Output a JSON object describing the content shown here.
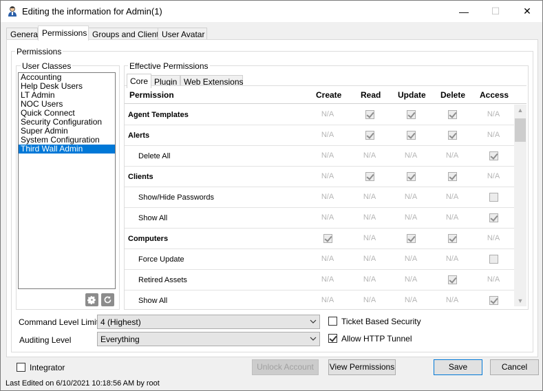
{
  "window": {
    "title": "Editing the information for Admin(1)",
    "minimize_glyph": "—",
    "maximize_glyph": "☐",
    "close_glyph": "✕"
  },
  "tabs": [
    {
      "label": "General"
    },
    {
      "label": "Permissions"
    },
    {
      "label": "Groups and Clients"
    },
    {
      "label": "User Avatar"
    }
  ],
  "permissions_group": {
    "label": "Permissions"
  },
  "user_classes": {
    "label": "User Classes",
    "items": [
      "Accounting",
      "Help Desk Users",
      "LT Admin",
      "NOC Users",
      "Quick Connect",
      "Security Configuration",
      "Super Admin",
      "System Configuration",
      "Third Wall Admin"
    ],
    "selected_index": 8,
    "settings_icon": "gear-icon",
    "refresh_icon": "refresh-icon"
  },
  "effective": {
    "label": "Effective Permissions",
    "subtabs": [
      {
        "label": "Core"
      },
      {
        "label": "Plugin"
      },
      {
        "label": "Web Extensions"
      }
    ],
    "columns": {
      "permission": "Permission",
      "create": "Create",
      "read": "Read",
      "update": "Update",
      "delete": "Delete",
      "access": "Access"
    },
    "rows": [
      {
        "name": "Agent Templates",
        "level": "main",
        "create": "N/A",
        "read": "checked",
        "update": "checked",
        "delete": "checked",
        "access": "N/A"
      },
      {
        "name": "Alerts",
        "level": "main",
        "create": "N/A",
        "read": "checked",
        "update": "checked",
        "delete": "checked",
        "access": "N/A"
      },
      {
        "name": "Delete All",
        "level": "sub",
        "create": "N/A",
        "read": "N/A",
        "update": "N/A",
        "delete": "N/A",
        "access": "checked"
      },
      {
        "name": "Clients",
        "level": "main",
        "create": "N/A",
        "read": "checked",
        "update": "checked",
        "delete": "checked",
        "access": "N/A"
      },
      {
        "name": "Show/Hide Passwords",
        "level": "sub",
        "create": "N/A",
        "read": "N/A",
        "update": "N/A",
        "delete": "N/A",
        "access": "unchecked"
      },
      {
        "name": "Show All",
        "level": "sub",
        "create": "N/A",
        "read": "N/A",
        "update": "N/A",
        "delete": "N/A",
        "access": "checked"
      },
      {
        "name": "Computers",
        "level": "main",
        "create": "checked",
        "read": "N/A",
        "update": "checked",
        "delete": "checked",
        "access": "N/A"
      },
      {
        "name": "Force Update",
        "level": "sub",
        "create": "N/A",
        "read": "N/A",
        "update": "N/A",
        "delete": "N/A",
        "access": "unchecked"
      },
      {
        "name": "Retired Assets",
        "level": "sub",
        "create": "N/A",
        "read": "N/A",
        "update": "N/A",
        "delete": "checked",
        "access": "N/A"
      },
      {
        "name": "Show All",
        "level": "sub",
        "create": "N/A",
        "read": "N/A",
        "update": "N/A",
        "delete": "N/A",
        "access": "checked"
      }
    ]
  },
  "command_level": {
    "label": "Command Level Limit",
    "value": "4 (Highest)"
  },
  "auditing_level": {
    "label": "Auditing Level",
    "value": "Everything"
  },
  "ticket_based_security": {
    "label": "Ticket Based Security",
    "checked": false
  },
  "allow_http_tunnel": {
    "label": "Allow HTTP Tunnel",
    "checked": true
  },
  "integrator": {
    "label": "Integrator",
    "checked": false
  },
  "buttons": {
    "unlock_account": "Unlock Account",
    "view_permissions": "View Permissions",
    "save": "Save",
    "cancel": "Cancel"
  },
  "status": {
    "text": "Last Edited on 6/10/2021 10:18:56 AM by root"
  },
  "colors": {
    "selection": "#0078d7",
    "window_bg": "#f0f0f0",
    "panel_bg": "#ffffff"
  }
}
